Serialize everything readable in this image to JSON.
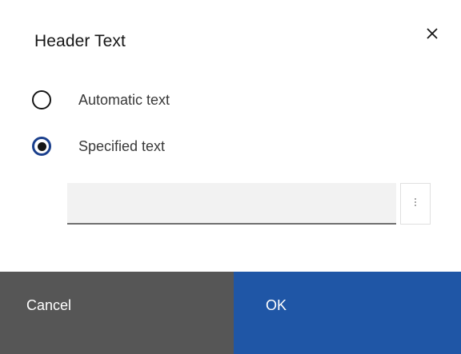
{
  "dialog": {
    "title": "Header Text",
    "close_icon": "close-icon"
  },
  "options": [
    {
      "label": "Automatic text",
      "selected": false
    },
    {
      "label": "Specified text",
      "selected": true
    }
  ],
  "text_field": {
    "value": "",
    "more_icon": "overflow-menu-vertical-icon"
  },
  "footer": {
    "cancel_label": "Cancel",
    "ok_label": "OK"
  },
  "colors": {
    "primary": "#1f56a6",
    "secondary": "#565656",
    "radio_selected_ring": "#1a3f8c"
  }
}
